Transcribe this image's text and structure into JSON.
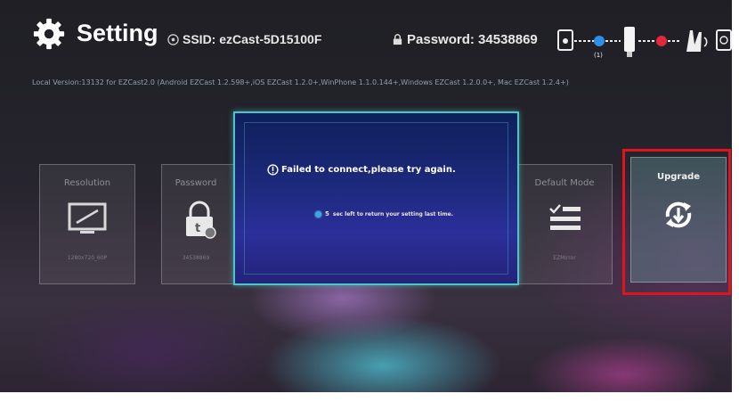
{
  "header": {
    "title": "Setting",
    "ssid_label": "SSID: ezCast-5D15100F",
    "password_label": "Password: 34538869",
    "version": "Local Version:13132 for EZCast2.0   (Android EZCast 1.2.598+,iOS EZCast 1.2.0+,WinPhone 1.1.0.144+,Windows EZCast 1.2.0.0+, Mac EZCast 1.2.4+)",
    "diagram_marker": "(1)"
  },
  "tiles": [
    {
      "label": "Resolution",
      "value": "1280x720_60P",
      "icon": "monitor-icon"
    },
    {
      "label": "Password",
      "value": "34538869",
      "icon": "lock-icon"
    },
    {
      "label": "Default Mode",
      "value": "EZMirror",
      "icon": "list-icon"
    },
    {
      "label": "Upgrade",
      "value": "",
      "icon": "upgrade-icon"
    }
  ],
  "dialog": {
    "message": "Failed to connect,please try again.",
    "countdown_value": "5",
    "countdown_text": "sec left to return your setting last time."
  },
  "colors": {
    "dialog_border": "#48c6c8",
    "dialog_bg": "#1e2a7e",
    "highlight": "#e0141c",
    "countdown_dot": "#39a6e8"
  }
}
